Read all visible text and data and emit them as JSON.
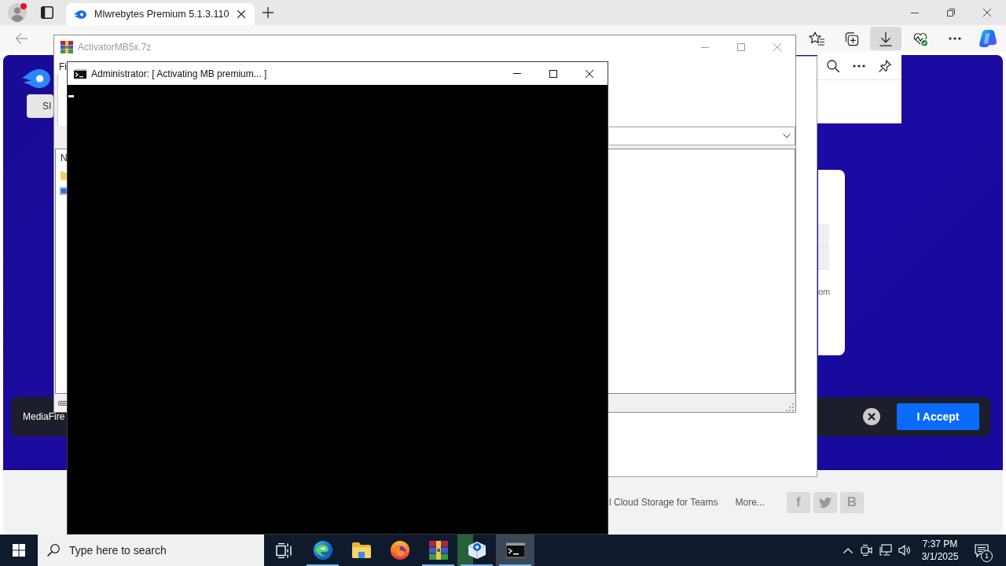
{
  "browser": {
    "profile_alert": true,
    "tab": {
      "title": "Mlwrebytes Premium 5.1.3.110",
      "selected": true
    },
    "back_button": {
      "disabled": true
    },
    "toolbar": [
      {
        "kind": "favorites",
        "selected": false
      },
      {
        "kind": "collections",
        "selected": false
      },
      {
        "kind": "downloads",
        "selected": true
      },
      {
        "kind": "essentials",
        "selected": false
      },
      {
        "kind": "more",
        "selected": false
      },
      {
        "kind": "copilot",
        "selected": false
      }
    ]
  },
  "page": {
    "signin_button": "SI",
    "card_text": "om",
    "cookie_bar": {
      "text": "MediaFire",
      "accept_button": "I Accept"
    },
    "footer_links": [
      "l Cloud Storage for Teams",
      "More..."
    ],
    "social": [
      {
        "kind": "letter",
        "label": "f"
      },
      {
        "kind": "bird"
      },
      {
        "kind": "letter",
        "label": "B"
      }
    ]
  },
  "winrar": {
    "title": "ActivatorMB5x.7z",
    "active": false,
    "menu": [
      "Fi"
    ],
    "column_header": "N"
  },
  "cmd": {
    "title": "Administrator: [ Activating MB premium... ]",
    "active": true
  },
  "taskbar": {
    "search_placeholder": "Type here to search",
    "apps": [
      {
        "kind": "edge",
        "running": true,
        "selected": false
      },
      {
        "kind": "explorer",
        "running": false,
        "selected": false
      },
      {
        "kind": "firefox",
        "running": false,
        "selected": false
      },
      {
        "kind": "winrar",
        "running": true,
        "selected": false
      },
      {
        "kind": "installer",
        "running": true,
        "selected": false,
        "level": 0.4
      },
      {
        "kind": "terminal",
        "running": true,
        "selected": true
      }
    ],
    "time": "7:37 PM",
    "date": "3/1/2025",
    "notification_count": "1"
  }
}
